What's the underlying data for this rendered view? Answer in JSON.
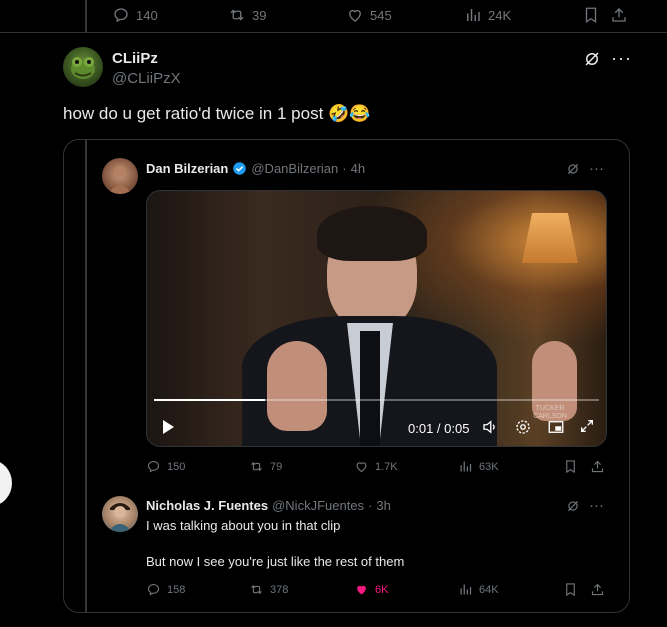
{
  "top_actions": {
    "replies": "140",
    "reposts": "39",
    "likes": "545",
    "views": "24K"
  },
  "main_post": {
    "name": "CLiiPz",
    "handle": "@CLiiPzX",
    "text": "how do u get ratio'd twice in 1 post",
    "emojis": "🤣😂"
  },
  "quoted_post": {
    "name": "Dan Bilzerian",
    "handle": "@DanBilzerian",
    "dot": "·",
    "time": "4h",
    "video": {
      "time_display": "0:01 / 0:05",
      "watermark": "TUCKER CARLSON",
      "progress": 0.25
    },
    "actions": {
      "replies": "150",
      "reposts": "79",
      "likes": "1.7K",
      "views": "63K"
    }
  },
  "reply_post": {
    "name": "Nicholas J. Fuentes",
    "handle": "@NickJFuentes",
    "dot": "·",
    "time": "3h",
    "line1": "I was talking about you in that clip",
    "line2": "But now I see you're just like the rest of them",
    "actions": {
      "replies": "158",
      "reposts": "378",
      "likes": "6K",
      "views": "64K"
    },
    "colors": {
      "liked": "#f91880"
    }
  },
  "colors": {
    "verified": "#1d9bf0",
    "background": "#000000",
    "muted": "#71767b"
  }
}
